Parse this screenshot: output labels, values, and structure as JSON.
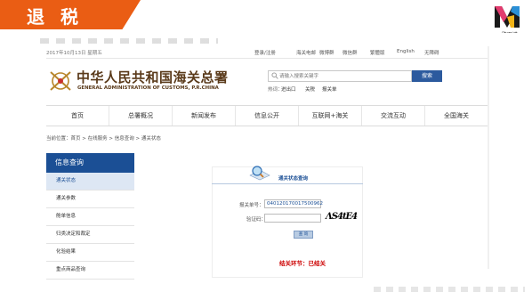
{
  "slide": {
    "tag": "退税",
    "brand": "一路跟进"
  },
  "topbar": {
    "date": "2017年10月13日 星期五",
    "links": [
      "登录/注册",
      "海关电邮",
      "微博群",
      "微信群",
      "繁體版",
      "English",
      "无障碍"
    ]
  },
  "site": {
    "title_cn": "中华人民共和国海关总署",
    "title_en": "GENERAL ADMINISTRATION OF CUSTOMS, P.R.CHINA"
  },
  "search": {
    "placeholder": "请输入搜索关键字",
    "button": "搜索",
    "hot_label": "热词：",
    "hot_words": [
      "进出口",
      "关税",
      "报关单"
    ]
  },
  "nav": [
    "首页",
    "总署概况",
    "新闻发布",
    "信息公开",
    "互联网+海关",
    "交流互动",
    "全国海关"
  ],
  "breadcrumb": "当前位置：首页 > 在线服务 > 信息查询 > 通关状态",
  "sidebar": {
    "title": "信息查询",
    "items": [
      "通关状态",
      "通关参数",
      "舱单信息",
      "归类决定和裁定",
      "化验结果",
      "重点商品查询"
    ]
  },
  "query": {
    "title": "通关状态查询",
    "decl_label": "报关单号：",
    "decl_value": "040120170017500962",
    "captcha_label": "验证码：",
    "captcha_text": "ΛS4tE4",
    "button": "查 询",
    "status_label": "结关环节：",
    "status_value": "已结关"
  },
  "colors": {
    "accent": "#ea5d14",
    "brand_blue": "#1b4f95",
    "result_red": "#cc0000"
  }
}
